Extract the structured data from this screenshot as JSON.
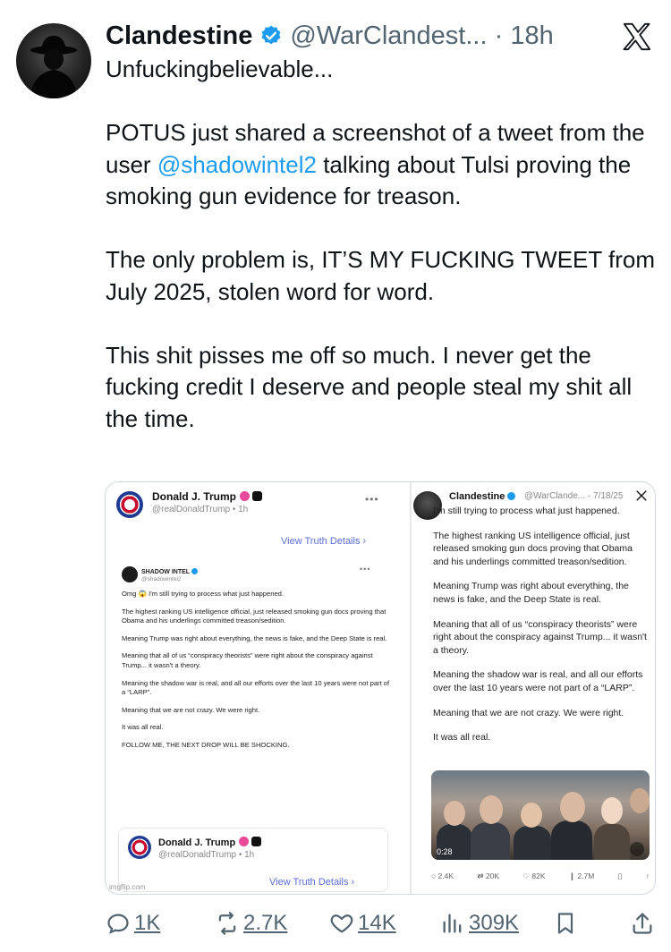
{
  "tweet": {
    "author_name": "Clandestine",
    "handle": "@WarClandest...",
    "time": "18h",
    "lines": [
      "Unfuckingbelievable..."
    ],
    "para2_before": "POTUS just shared a screenshot of a tweet from the user ",
    "para2_mention": "@shadowintel2",
    "para2_after": " talking about Tulsi proving the smoking gun evidence for treason.",
    "para3": "The only problem is, IT’S MY FUCKING TWEET from July 2025, stolen word for word.",
    "para4": "This shit pisses me off so much. I never get the fucking credit I deserve and people steal my shit all the time."
  },
  "media": {
    "left": {
      "name": "Donald J. Trump",
      "handle": "@realDonaldTrump • 1h",
      "view_details": "View Truth Details",
      "inner_name": "SHADOW INTEL",
      "inner_handle": "@shadowintel2",
      "inner_paragraphs": [
        "Omg 😱 I'm still trying to process what just happened.",
        "The highest ranking US intelligence official, just released smoking gun docs proving that Obama and his underlings committed treason/sedition.",
        "Meaning Trump was right about everything, the news is fake, and the Deep State is real.",
        "Meaning that all of us “conspiracy theorists” were right about the conspiracy against Trump... it wasn't a theory.",
        "Meaning the shadow war is real, and all our efforts over the last 10 years were not part of a “LARP”.",
        "Meaning that we are not crazy. We were right.",
        "It was all real.",
        "FOLLOW ME, THE NEXT DROP WILL BE SHOCKING."
      ],
      "lower_name": "Donald J. Trump",
      "lower_handle": "@realDonaldTrump • 1h",
      "lower_view_details": "View Truth Details",
      "watermark": "imgflip.com"
    },
    "right": {
      "name": "Clandestine",
      "handle": "@WarClande... · 7/18/25",
      "paragraphs": [
        "I'm still trying to process what just happened.",
        "The highest ranking US intelligence official, just released smoking gun docs proving that Obama and his underlings committed treason/sedition.",
        "Meaning Trump was right about everything, the news is fake, and the Deep State is real.",
        "Meaning that all of us “conspiracy theorists” were right about the conspiracy against Trump... it wasn't a theory.",
        "Meaning the shadow war is real, and all our efforts over the last 10 years were not part of a “LARP”.",
        "Meaning that we are not crazy. We were right.",
        "It was all real."
      ],
      "video_duration": "0:28",
      "stats": {
        "replies": "2.4K",
        "reposts": "20K",
        "likes": "82K",
        "views": "2.7M"
      }
    }
  },
  "actions": {
    "replies": "1K",
    "reposts": "2.7K",
    "likes": "14K",
    "views": "309K"
  },
  "colors": {
    "accent": "#1d9bf0",
    "text": "#0f1419",
    "muted": "#536471"
  }
}
